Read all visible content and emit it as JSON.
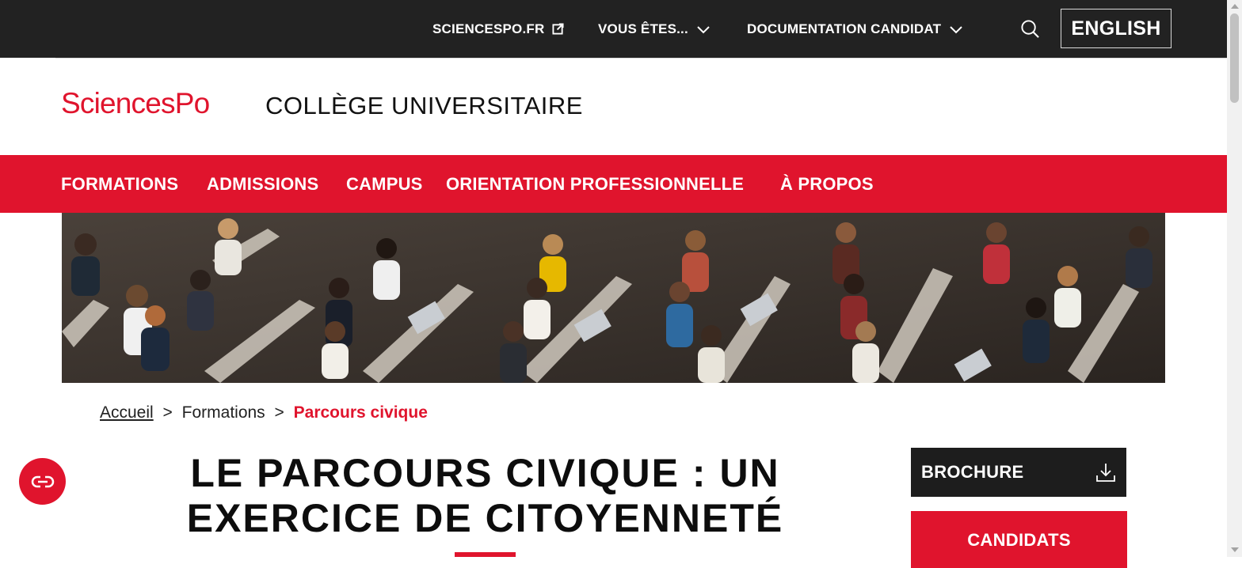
{
  "topbar": {
    "sciencespo_link": "SCIENCESPO.FR",
    "vous_etes": "VOUS ÊTES...",
    "documentation": "DOCUMENTATION CANDIDAT",
    "language": "ENGLISH"
  },
  "header": {
    "logo": "SciencesPo",
    "site_title": "COLLÈGE UNIVERSITAIRE"
  },
  "mainnav": {
    "items": [
      "FORMATIONS",
      "ADMISSIONS",
      "CAMPUS",
      "ORIENTATION PROFESSIONNELLE",
      "À PROPOS"
    ]
  },
  "breadcrumb": {
    "home": "Accueil",
    "sep": ">",
    "level1": "Formations",
    "current": "Parcours civique"
  },
  "page": {
    "title_line1": "LE PARCOURS CIVIQUE : UN",
    "title_line2": "EXERCICE DE CITOYENNETÉ"
  },
  "sidebar": {
    "brochure": "BROCHURE",
    "candidats": "CANDIDATS"
  },
  "colors": {
    "brand_red": "#e0142d",
    "topbar_dark": "#222222",
    "brochure_dark": "#1d1d1d"
  },
  "icons": {
    "external": "external-link-icon",
    "chevron": "chevron-down-icon",
    "search": "search-icon",
    "download": "download-icon",
    "chat": "chat-icon"
  }
}
